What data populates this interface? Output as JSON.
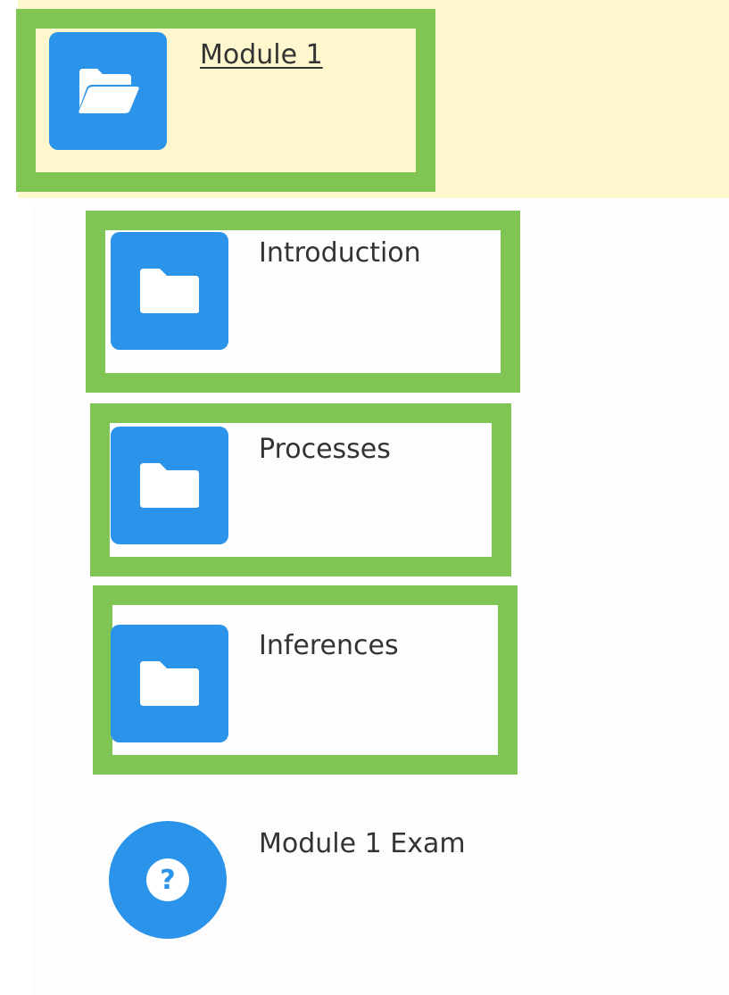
{
  "module": {
    "title": "Module 1",
    "icon": "folder-open-icon"
  },
  "items": [
    {
      "label": "Introduction",
      "icon": "folder-icon"
    },
    {
      "label": "Processes",
      "icon": "folder-icon"
    },
    {
      "label": "Inferences",
      "icon": "folder-icon"
    }
  ],
  "exam": {
    "label": "Module 1 Exam",
    "icon": "question-icon"
  },
  "colors": {
    "tile": "#2b93ea",
    "highlight": "#80c554",
    "module_row_bg": "#fef7cd"
  }
}
